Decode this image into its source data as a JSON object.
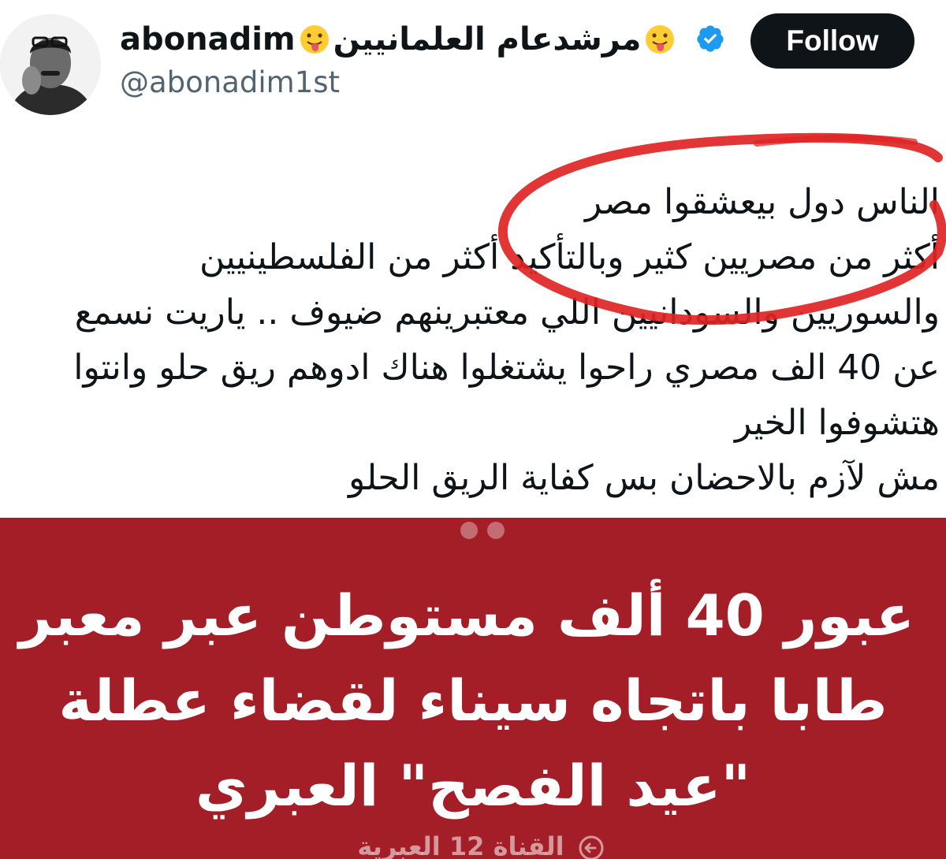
{
  "header": {
    "display_name_latin": "abonadim",
    "display_name_arabic": "مرشدعام العلمانيين",
    "handle": "@abonadim1st",
    "follow_label": "Follow",
    "verified": true
  },
  "tweet": {
    "lines": [
      "الناس دول بيعشقوا مصر",
      "أكثر من مصريين كثير وبالتأكيد أكثر من الفلسطينيين",
      "والسوريين والسودانيين اللي معتبرينهم ضيوف .. ياريت نسمع",
      "عن 40 الف مصري راحوا يشتغلوا هناك ادوهم ريق حلو وانتوا",
      "هتشوفوا الخير",
      "مش لآزم بالاحضان بس كفاية الريق الحلو"
    ]
  },
  "media": {
    "headline_lines": [
      "عبور 40 ألف مستوطن عبر معبر",
      "طابا باتجاه سيناء لقضاء عطلة",
      "\"عيد الفصح\" العبري"
    ],
    "source": "القناة 12 العبرية"
  },
  "icons": {
    "emoji": "tongue-face-emoji",
    "verified": "verified-badge-icon",
    "source_arrow": "arrow-circle-icon"
  },
  "colors": {
    "follow_bg": "#0f1419",
    "verified_blue": "#1d9bf0",
    "handle_gray": "#536471",
    "media_red": "#a31e26",
    "annotation_red": "#e02424"
  }
}
